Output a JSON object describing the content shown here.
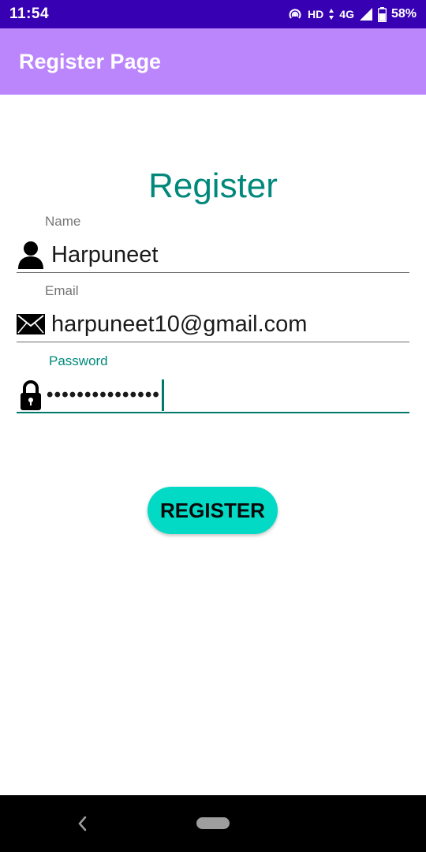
{
  "status_bar": {
    "time": "11:54",
    "network": "HD",
    "signal_type": "4G",
    "battery": "58%"
  },
  "app_bar": {
    "title": "Register Page"
  },
  "form": {
    "heading": "Register",
    "name": {
      "label": "Name",
      "value": "Harpuneet",
      "icon": "person-icon"
    },
    "email": {
      "label": "Email",
      "value": "harpuneet10@gmail.com",
      "icon": "envelope-icon"
    },
    "password": {
      "label": "Password",
      "masked_value": "•••••••••••••••",
      "icon": "lock-icon"
    },
    "submit_label": "REGISTER"
  },
  "colors": {
    "status_bar": "#3700b3",
    "app_bar": "#bb86fc",
    "accent": "#00897b",
    "button": "#03dac5"
  }
}
